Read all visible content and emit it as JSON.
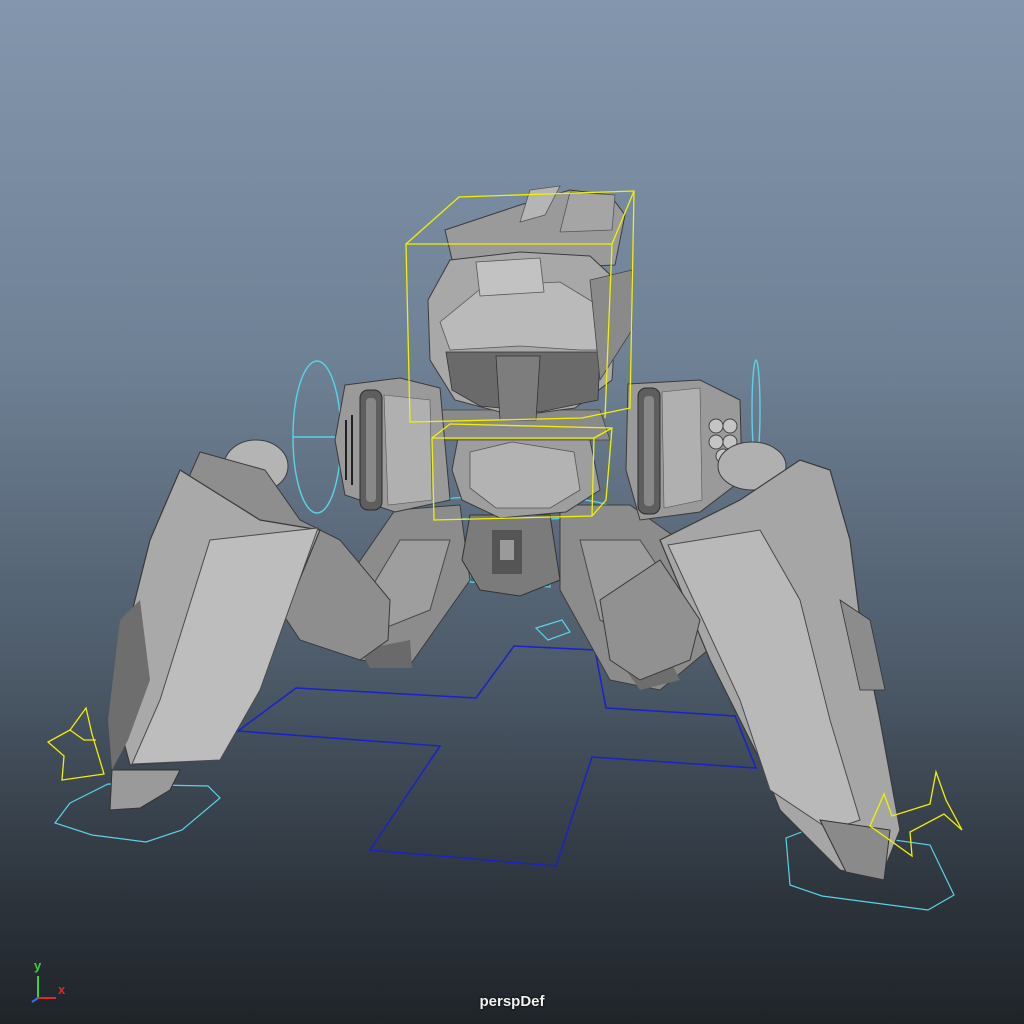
{
  "viewport": {
    "camera_name": "perspDef"
  },
  "axis_gizmo": {
    "y_label": "y",
    "x_label": "x",
    "y_color": "#3ad23a",
    "x_color": "#e02828",
    "z_color": "#3a6cff"
  },
  "colors": {
    "selection_box": "#f0f000",
    "control_curve": "#5ad2e6",
    "grid_curve": "#1a22c8",
    "mesh_light": "#a7a7a7",
    "mesh_mid": "#8c8c8c",
    "mesh_dark": "#555555"
  }
}
